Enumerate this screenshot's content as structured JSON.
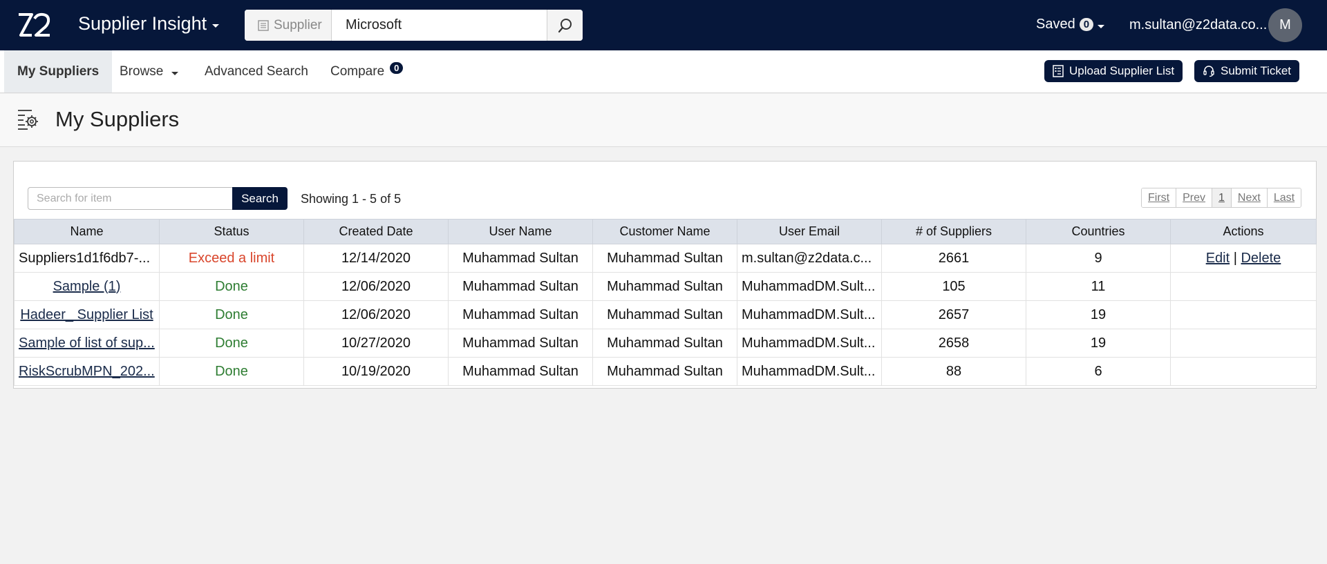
{
  "colors": {
    "brand": "#06173a",
    "status_warn": "#d9452b",
    "status_done": "#2e7d32"
  },
  "header": {
    "logo_icon": "z2-logo",
    "app_title": "Supplier Insight",
    "search": {
      "type_label": "Supplier",
      "value": "Microsoft",
      "search_icon": "magnifier-icon"
    },
    "saved_label": "Saved",
    "saved_count": "0",
    "user_email": "m.sultan@z2data.co...",
    "avatar_initial": "M"
  },
  "nav": {
    "my_suppliers": "My Suppliers",
    "browse": "Browse",
    "advanced_search": "Advanced Search",
    "compare": "Compare",
    "compare_count": "0",
    "upload_btn": "Upload Supplier List",
    "submit_ticket_btn": "Submit Ticket"
  },
  "page": {
    "title": "My Suppliers"
  },
  "table": {
    "search_placeholder": "Search for item",
    "search_button": "Search",
    "showing": "Showing 1 - 5 of 5",
    "pager": {
      "first": "First",
      "prev": "Prev",
      "current": "1",
      "next": "Next",
      "last": "Last"
    },
    "columns": [
      "Name",
      "Status",
      "Created Date",
      "User Name",
      "Customer Name",
      "User Email",
      "# of Suppliers",
      "Countries",
      "Actions"
    ],
    "rows": [
      {
        "name": "Suppliers1d1f6db7-...",
        "status": "Exceed a limit",
        "created": "12/14/2020",
        "user": "Muhammad Sultan",
        "customer": "Muhammad Sultan",
        "email": "m.sultan@z2data.c...",
        "suppliers": "2661",
        "countries": "9",
        "edit": "Edit",
        "sep": "|",
        "delete": "Delete"
      },
      {
        "name": "Sample (1)",
        "status": "Done",
        "created": "12/06/2020",
        "user": "Muhammad Sultan",
        "customer": "Muhammad Sultan",
        "email": "MuhammadDM.Sult...",
        "suppliers": "105",
        "countries": "11"
      },
      {
        "name": "Hadeer_ Supplier List",
        "status": "Done",
        "created": "12/06/2020",
        "user": "Muhammad Sultan",
        "customer": "Muhammad Sultan",
        "email": "MuhammadDM.Sult...",
        "suppliers": "2657",
        "countries": "19"
      },
      {
        "name": "Sample of list of sup...",
        "status": "Done",
        "created": "10/27/2020",
        "user": "Muhammad Sultan",
        "customer": "Muhammad Sultan",
        "email": "MuhammadDM.Sult...",
        "suppliers": "2658",
        "countries": "19"
      },
      {
        "name": "RiskScrubMPN_202...",
        "status": "Done",
        "created": "10/19/2020",
        "user": "Muhammad Sultan",
        "customer": "Muhammad Sultan",
        "email": "MuhammadDM.Sult...",
        "suppliers": "88",
        "countries": "6"
      }
    ]
  }
}
